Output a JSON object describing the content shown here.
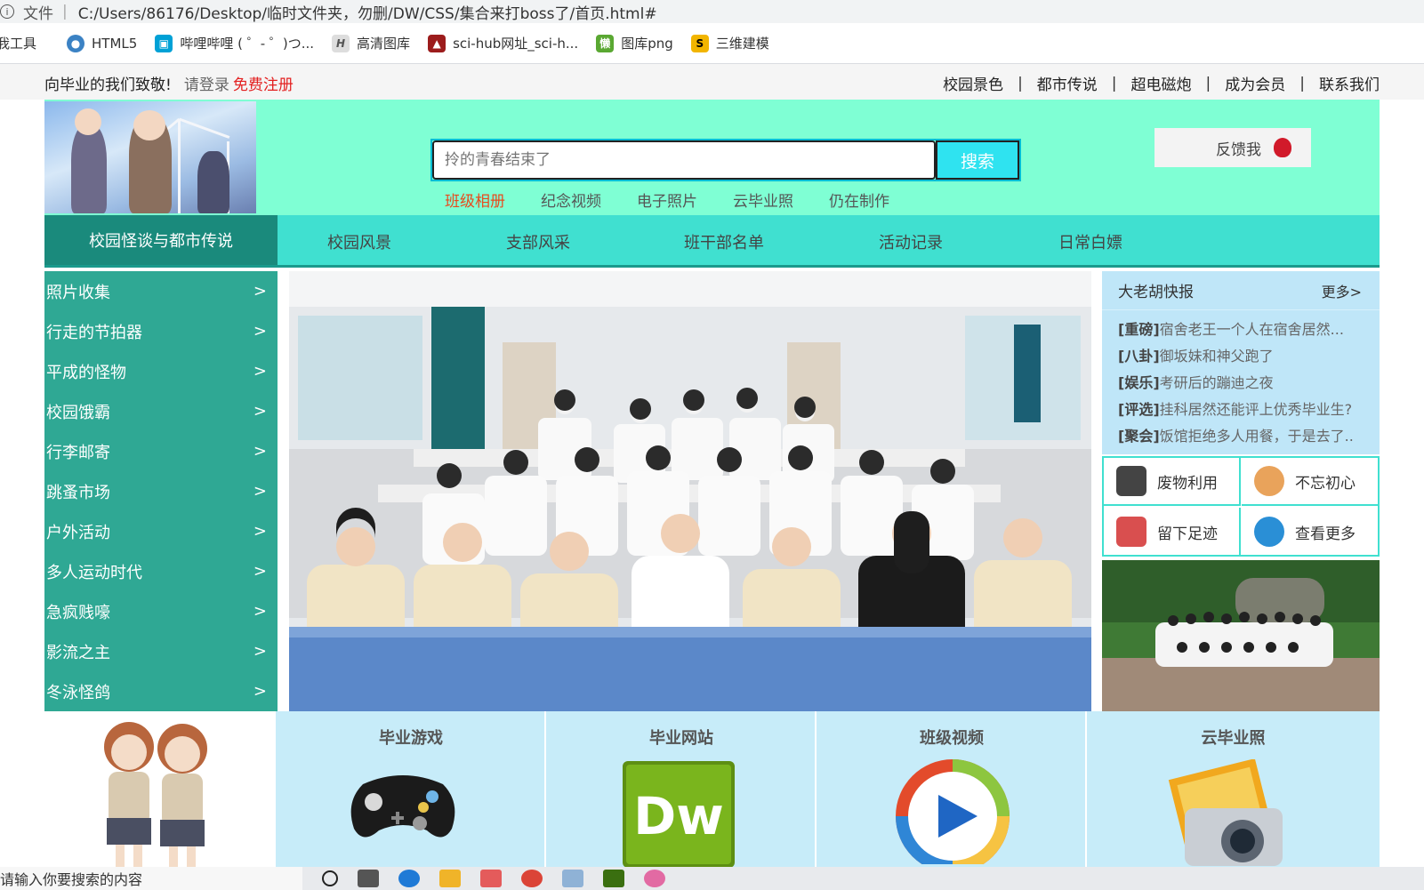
{
  "browser": {
    "info_icon": "info-icon",
    "file_label": "文件",
    "url": "C:/Users/86176/Desktop/临时文件夹，勿删/DW/CSS/集合来打boss了/首页.html#",
    "bookmarks": [
      {
        "label": "我工具",
        "icon": "apps-icon",
        "color": "#ffffff"
      },
      {
        "label": "HTML5",
        "icon": "html5-icon",
        "color": "#3b82c4"
      },
      {
        "label": "哔哩哔哩 ( ゜- ゜)つ...",
        "icon": "bilibili-icon",
        "color": "#00a1d6"
      },
      {
        "label": "高清图库",
        "icon": "photo-library-icon",
        "color": "#555555"
      },
      {
        "label": "sci-hub网址_sci-h...",
        "icon": "scihub-icon",
        "color": "#9c1c1c"
      },
      {
        "label": "图库png",
        "icon": "png-library-icon",
        "color": "#5aa832"
      },
      {
        "label": "三维建模",
        "icon": "3d-model-icon",
        "color": "#f2b500"
      }
    ]
  },
  "topbar": {
    "welcome": "向毕业的我们致敬!",
    "login": "请登录",
    "register": "免费注册",
    "links": [
      "校园景色",
      "都市传说",
      "超电磁炮",
      "成为会员",
      "联系我们"
    ],
    "separator": "|"
  },
  "header": {
    "search_placeholder": "拎的青春结束了",
    "search_button": "搜索",
    "sublinks": [
      "班级相册",
      "纪念视频",
      "电子照片",
      "云毕业照",
      "仍在制作"
    ],
    "feedback": "反馈我"
  },
  "nav": {
    "first": "校园怪谈与都市传说",
    "items": [
      "校园风景",
      "支部风采",
      "班干部名单",
      "活动记录",
      "日常白嫖"
    ]
  },
  "sidemenu": {
    "arrow": ">",
    "items": [
      "照片收集",
      "行走的节拍器",
      "平成的怪物",
      "校园饿霸",
      "行李邮寄",
      "跳蚤市场",
      "户外活动",
      "多人运动时代",
      "急疯贱嚎",
      "影流之主",
      "冬泳怪鸽"
    ]
  },
  "news": {
    "title": "大老胡快报",
    "more": "更多>",
    "items": [
      {
        "tag": "[重磅]",
        "text": "宿舍老王一个人在宿舍居然..."
      },
      {
        "tag": "[八卦]",
        "text": "御坂妹和神父跑了"
      },
      {
        "tag": "[娱乐]",
        "text": "考研后的蹦迪之夜"
      },
      {
        "tag": "[评选]",
        "text": "挂科居然还能评上优秀毕业生?"
      },
      {
        "tag": "[聚会]",
        "text": "饭馆拒绝多人用餐，于是去了.."
      }
    ]
  },
  "quick": [
    {
      "label": "废物利用",
      "icon": "phone-hand-icon",
      "color": "#333333"
    },
    {
      "label": "不忘初心",
      "icon": "anime-girl-icon",
      "color": "#e9a35b"
    },
    {
      "label": "留下足迹",
      "icon": "people-group-icon",
      "color": "#d94f4f"
    },
    {
      "label": "查看更多",
      "icon": "download-arrow-icon",
      "color": "#2a8fd6"
    }
  ],
  "cards": [
    {
      "title": "毕业游戏",
      "icon": "gamepad-icon"
    },
    {
      "title": "毕业网站",
      "icon": "dreamweaver-icon"
    },
    {
      "title": "班级视频",
      "icon": "media-player-icon"
    },
    {
      "title": "云毕业照",
      "icon": "camera-icon"
    }
  ],
  "taskbar": {
    "search": "请输入你要搜索的内容"
  }
}
